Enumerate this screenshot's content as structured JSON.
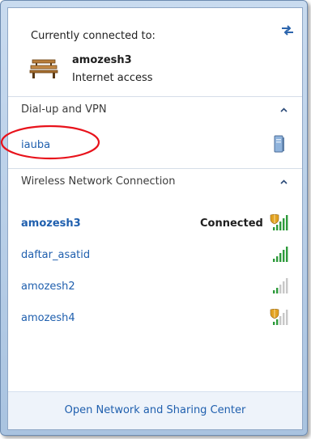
{
  "header": {
    "title": "Currently connected to:",
    "refresh_icon": "refresh-icon",
    "network": {
      "icon": "bench-icon",
      "name": "amozesh3",
      "status": "Internet access"
    }
  },
  "sections": {
    "dialup": {
      "label": "Dial-up and VPN",
      "items": [
        {
          "name": "iauba",
          "icon": "vpn-connection-icon"
        }
      ]
    },
    "wireless": {
      "label": "Wireless Network Connection",
      "items": [
        {
          "name": "amozesh3",
          "status": "Connected",
          "signal_bars": 5,
          "secured": true
        },
        {
          "name": "daftar_asatid",
          "signal_bars": 5,
          "secured": false
        },
        {
          "name": "amozesh2",
          "signal_bars": 2,
          "secured": false
        },
        {
          "name": "amozesh4",
          "signal_bars": 2,
          "secured": true
        }
      ]
    }
  },
  "footer": {
    "link": "Open Network and Sharing Center"
  },
  "colors": {
    "link": "#1f5fae",
    "signal_active": "#2e9b3c",
    "signal_inactive": "#c8c8c8",
    "shield": "#e2a221",
    "annotation": "#e8121b",
    "frame": "#a9c3e0"
  }
}
